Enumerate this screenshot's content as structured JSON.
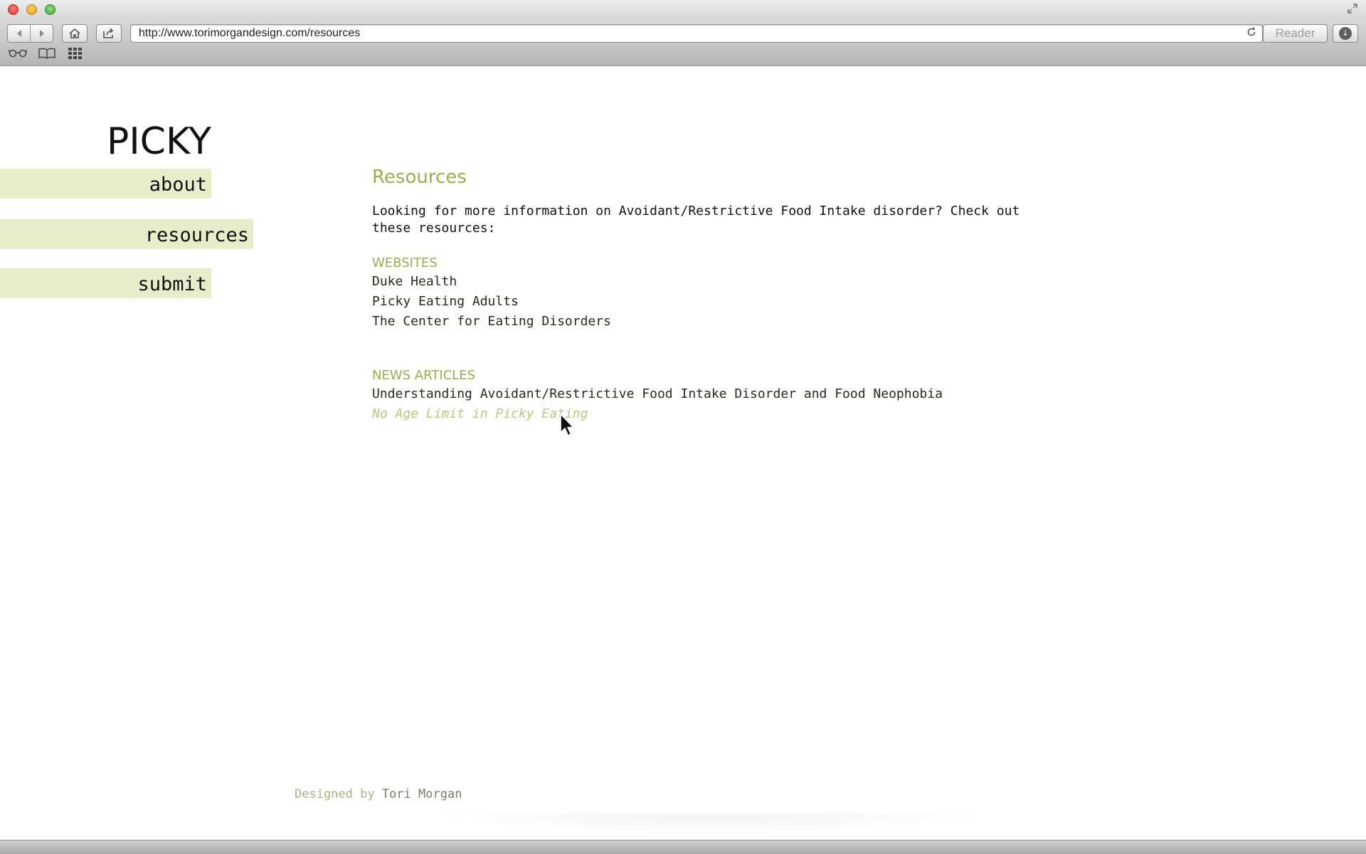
{
  "browser": {
    "url": "http://www.torimorgandesign.com/resources",
    "reader_label": "Reader",
    "icons": {
      "back": "back-arrow-icon",
      "forward": "forward-arrow-icon",
      "home": "home-icon",
      "share": "share-icon",
      "reload": "reload-icon",
      "download": "download-icon",
      "reading_list": "reading-list-icon",
      "bookmarks": "bookmarks-icon",
      "top_sites": "top-sites-icon"
    }
  },
  "site": {
    "logo": "PICKY",
    "nav": [
      {
        "label": "about"
      },
      {
        "label": "resources"
      },
      {
        "label": "submit"
      }
    ]
  },
  "content": {
    "title": "Resources",
    "intro": "Looking for more information on Avoidant/Restrictive Food Intake disorder? Check out these resources:",
    "websites_heading": "WEBSITES",
    "websites": [
      "Duke Health",
      "Picky Eating Adults",
      "The Center for Eating Disorders"
    ],
    "news_heading": "NEWS ARTICLES",
    "news": [
      "Understanding Avoidant/Restrictive Food Intake Disorder and Food Neophobia",
      "No Age Limit in Picky Eating"
    ]
  },
  "footer": {
    "prefix": "Designed by",
    "name": "Tori Morgan"
  },
  "colors": {
    "accent": "#9aae4a",
    "nav_bg": "#e7edc8",
    "link_hover": "#b9c97a"
  }
}
